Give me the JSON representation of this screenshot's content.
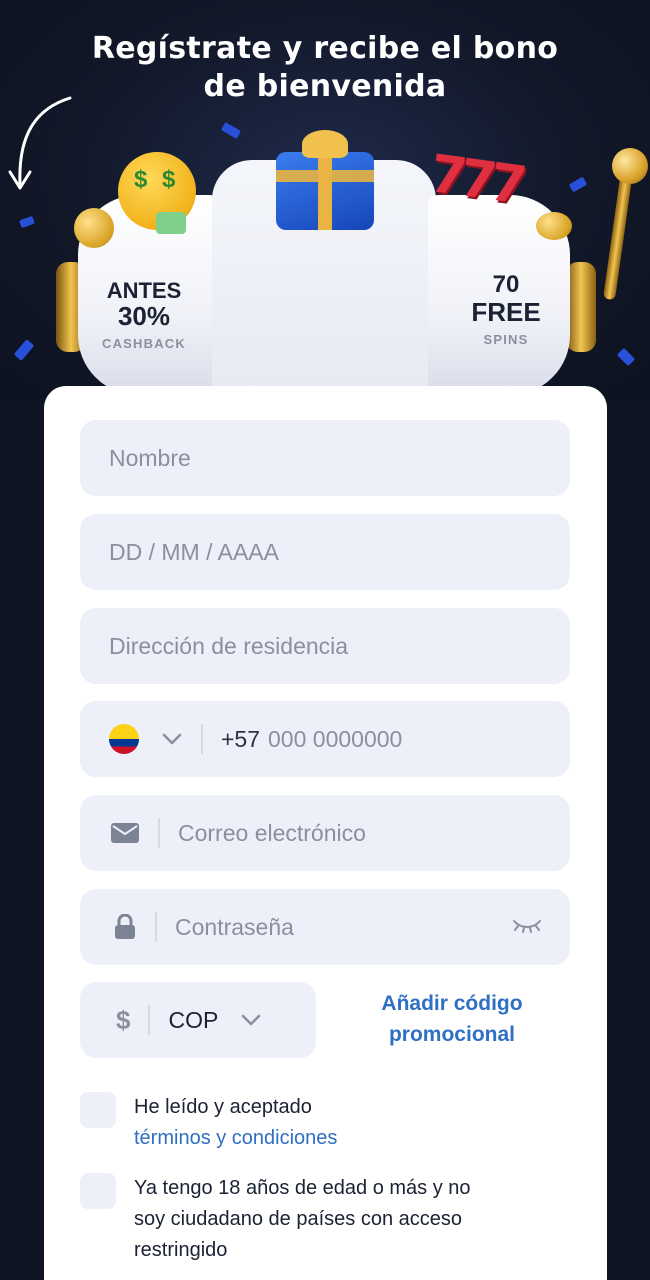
{
  "headline": {
    "line1": "Regístrate y recibe el bono",
    "line2": "de bienvenida"
  },
  "offers": {
    "left": {
      "l1": "ANTES",
      "l2": "30%",
      "l3": "CASHBACK"
    },
    "right": {
      "l1": "70",
      "l2": "FREE",
      "l3": "SPINS"
    }
  },
  "form": {
    "name_placeholder": "Nombre",
    "dob_placeholder": "DD / MM / AAAA",
    "address_placeholder": "Dirección de residencia",
    "phone": {
      "code": "+57",
      "placeholder": "000 0000000",
      "country_icon": "colombia-flag"
    },
    "email_placeholder": "Correo electrónico",
    "password_placeholder": "Contraseña",
    "currency": {
      "symbol": "$",
      "selected": "COP"
    },
    "promo": {
      "line1": "Añadir código",
      "line2": "promocional"
    },
    "terms": {
      "text": "He leído y aceptado",
      "link": "términos y condiciones"
    },
    "age": {
      "text": "Ya tengo 18 años de edad o más y no soy ciudadano de países con acceso restringido"
    }
  },
  "colors": {
    "accent": "#2f6fc4",
    "field_bg": "#edf0f8",
    "background": "#0f1422"
  }
}
